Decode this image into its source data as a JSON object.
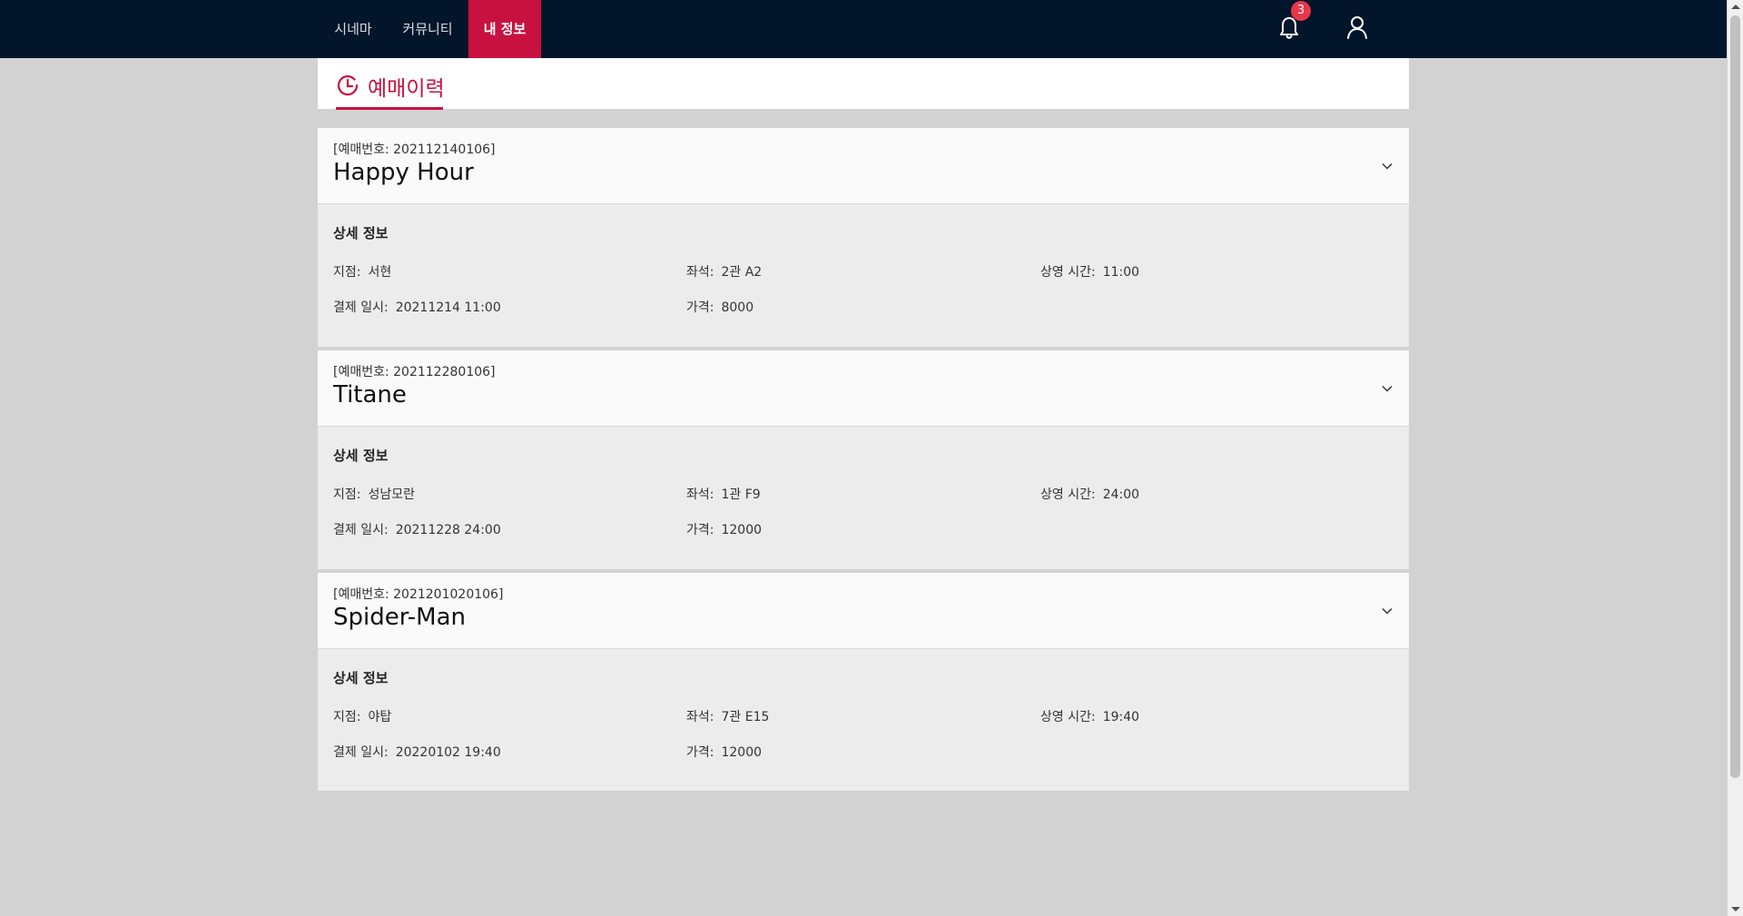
{
  "nav": {
    "items": [
      {
        "label": "시네마"
      },
      {
        "label": "커뮤니티"
      },
      {
        "label": "내 정보",
        "active": true
      }
    ],
    "notification_count": "3",
    "icons": {
      "bell": "bell-icon",
      "user": "user-icon"
    }
  },
  "page": {
    "title": "예매이력",
    "title_icon": "history-clock-icon"
  },
  "bookings": [
    {
      "booking_no": "[예매번호: 202112140106]",
      "title": "Happy Hour",
      "detail_header": "상세 정보",
      "branch_label": "지점:",
      "branch": "서현",
      "seat_label": "좌석:",
      "seat": "2관 A2",
      "showtime_label": "상영 시간:",
      "showtime": "11:00",
      "paid_label": "결제 일시:",
      "paid_at": "20211214 11:00",
      "price_label": "가격:",
      "price": "8000"
    },
    {
      "booking_no": "[예매번호: 202112280106]",
      "title": "Titane",
      "detail_header": "상세 정보",
      "branch_label": "지점:",
      "branch": "성남모란",
      "seat_label": "좌석:",
      "seat": "1관 F9",
      "showtime_label": "상영 시간:",
      "showtime": "24:00",
      "paid_label": "결제 일시:",
      "paid_at": "20211228 24:00",
      "price_label": "가격:",
      "price": "12000"
    },
    {
      "booking_no": "[예매번호: 2021201020106]",
      "title": "Spider-Man",
      "detail_header": "상세 정보",
      "branch_label": "지점:",
      "branch": "야탑",
      "seat_label": "좌석:",
      "seat": "7관 E15",
      "showtime_label": "상영 시간:",
      "showtime": "19:40",
      "paid_label": "결제 일시:",
      "paid_at": "20220102 19:40",
      "price_label": "가격:",
      "price": "12000"
    }
  ],
  "colors": {
    "nav_bg": "#02152a",
    "accent": "#c8113f",
    "badge": "#e8364b",
    "page_bg": "#d2d2d2",
    "card_head_bg": "#fafafa",
    "card_body_bg": "#ececec"
  }
}
